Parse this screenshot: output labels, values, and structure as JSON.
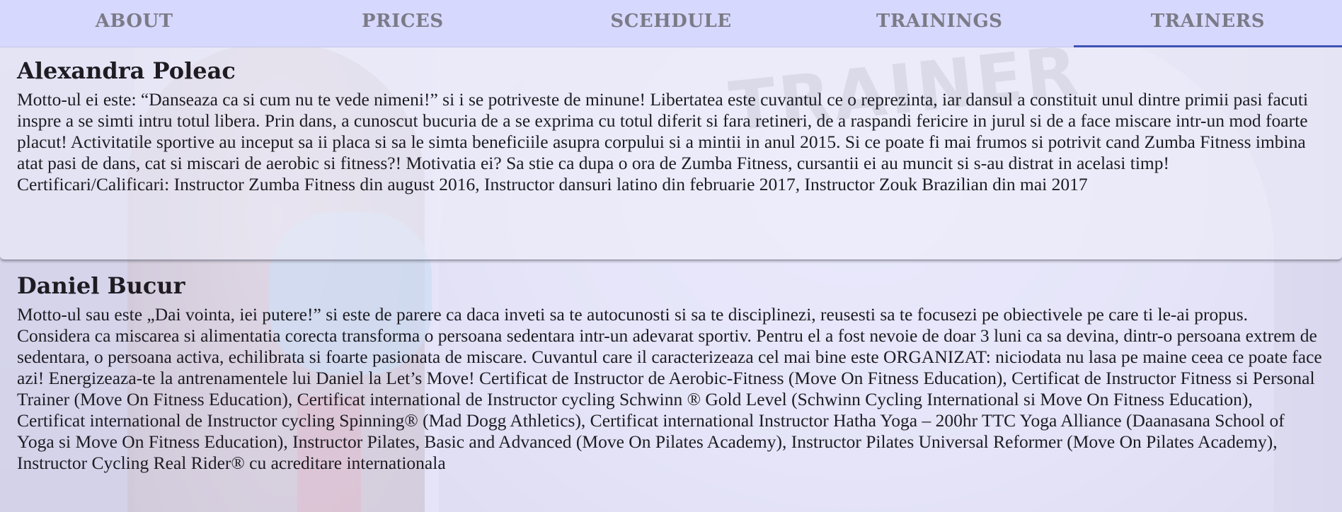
{
  "nav": {
    "tabs": [
      {
        "label": "ABOUT",
        "active": false
      },
      {
        "label": "PRICES",
        "active": false
      },
      {
        "label": "SCEHDULE",
        "active": false
      },
      {
        "label": "TRAININGS",
        "active": false
      },
      {
        "label": "TRAINERS",
        "active": true
      }
    ],
    "active_underline_color": "#3f51b5",
    "background_color": "#d7d8fd"
  },
  "background": {
    "photo_text": "TRAINER"
  },
  "trainers": [
    {
      "name": "Alexandra Poleac",
      "bio": "Motto-ul ei este: “Danseaza ca si cum nu te vede nimeni!” si i se potriveste de minune! Libertatea este cuvantul ce o reprezinta, iar dansul a constituit unul dintre primii pasi facuti inspre a se simti intru totul libera. Prin dans, a cunoscut bucuria de a se exprima cu totul diferit si fara retineri, de a raspandi fericire in jurul si de a face miscare intr-un mod foarte placut! Activitatile sportive au inceput sa ii placa si sa le simta beneficiile asupra corpului si a mintii in anul 2015. Si ce poate fi mai frumos si potrivit cand Zumba Fitness imbina atat pasi de dans, cat si miscari de aerobic si fitness?! Motivatia ei? Sa stie ca dupa o ora de Zumba Fitness, cursantii ei au muncit si s-au distrat in acelasi timp! Certificari/Calificari: Instructor Zumba Fitness din august 2016, Instructor dansuri latino din februarie 2017, Instructor Zouk Brazilian din mai 2017"
    },
    {
      "name": "Daniel Bucur",
      "bio": "Motto-ul sau este „Dai vointa, iei putere!” si este de parere ca daca inveti sa te autocunosti si sa te disciplinezi, reusesti sa te focusezi pe obiectivele pe care ti le-ai propus. Considera ca miscarea si alimentatia corecta transforma o persoana sedentara intr-un adevarat sportiv. Pentru el a fost nevoie de doar 3 luni ca sa devina, dintr-o persoana extrem de sedentara, o persoana activa, echilibrata si foarte pasionata de miscare. Cuvantul care il caracterizeaza cel mai bine este ORGANIZAT: niciodata nu lasa pe maine ceea ce poate face azi! Energizeaza-te la antrenamentele lui Daniel la Let’s Move! Certificat de Instructor de Aerobic-Fitness (Move On Fitness Education), Certificat de Instructor Fitness si Personal Trainer (Move On Fitness Education), Certificat international de Instructor cycling Schwinn ® Gold Level (Schwinn Cycling International si Move On Fitness Education), Certificat international de Instructor cycling Spinning® (Mad Dogg Athletics), Certificat international Instructor Hatha Yoga – 200hr TTC Yoga Alliance (Daanasana School of Yoga si Move On Fitness Education), Instructor Pilates, Basic and Advanced (Move On Pilates Academy), Instructor Pilates Universal Reformer (Move On Pilates Academy), Instructor Cycling Real Rider® cu acreditare internationala"
    }
  ]
}
